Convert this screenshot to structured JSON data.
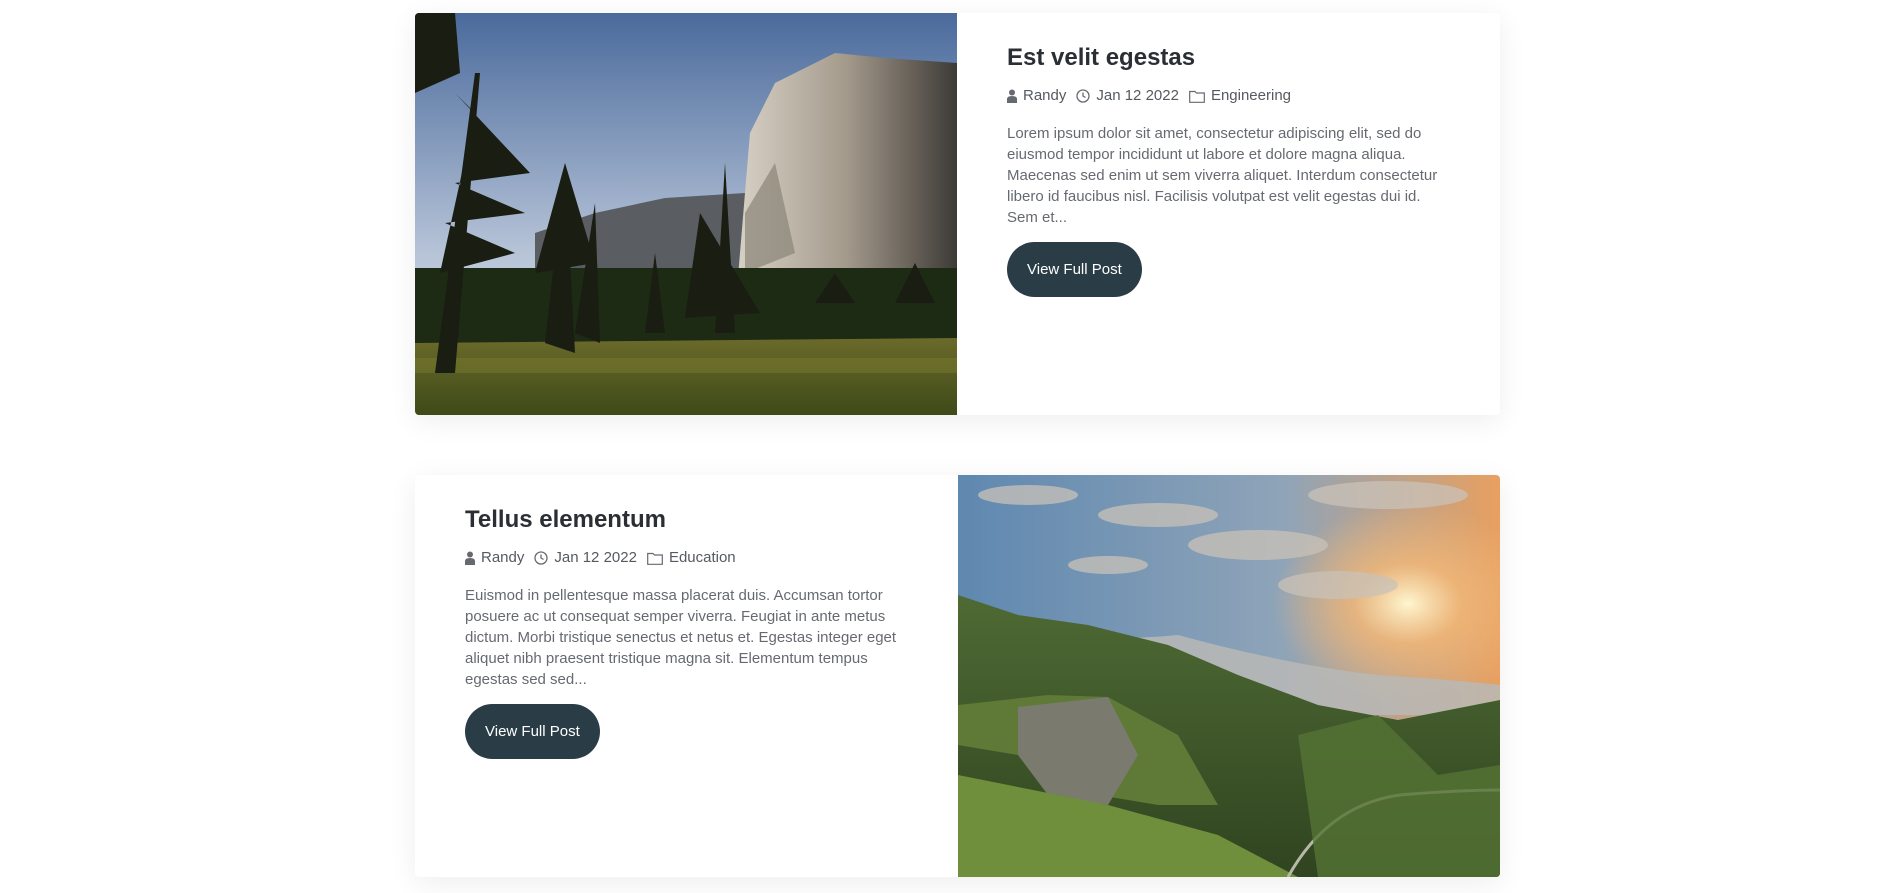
{
  "posts": [
    {
      "title": "Est velit egestas",
      "author": "Randy",
      "date": "Jan 12 2022",
      "category": "Engineering",
      "excerpt": "Lorem ipsum dolor sit amet, consectetur adipiscing elit, sed do eiusmod tempor incididunt ut labore et dolore magna aliqua. Maecenas sed enim ut sem viverra aliquet. Interdum consectetur libero id faucibus nisl. Facilisis volutpat est velit egestas dui id. Sem et...",
      "button_label": "View Full Post",
      "image_subject": "mountain-cliff-forest-photo"
    },
    {
      "title": "Tellus elementum",
      "author": "Randy",
      "date": "Jan 12 2022",
      "category": "Education",
      "excerpt": "Euismod in pellentesque massa placerat duis. Accumsan tortor posuere ac ut consequat semper viverra. Feugiat in ante metus dictum. Morbi tristique senectus et netus et. Egestas integer eget aliquet nibh praesent tristique magna sit. Elementum tempus egestas sed sed...",
      "button_label": "View Full Post",
      "image_subject": "green-valley-sunset-photo"
    }
  ],
  "colors": {
    "button_bg": "#2a3d47",
    "title": "#2b2f33",
    "text": "#666a70"
  }
}
